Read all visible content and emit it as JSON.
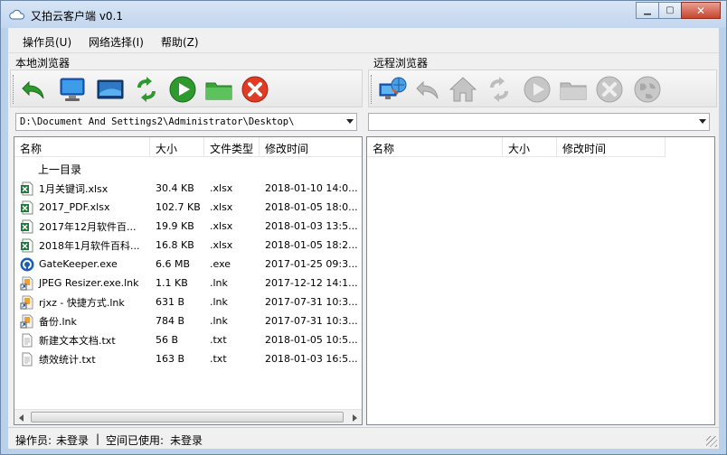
{
  "window": {
    "title": "又拍云客户端 v0.1",
    "controls": [
      "minimize",
      "maximize",
      "close"
    ]
  },
  "menu": {
    "items": [
      "操作员(U)",
      "网络选择(I)",
      "帮助(Z)"
    ]
  },
  "local": {
    "label": "本地浏览器",
    "toolbar": [
      "back-arrow-icon",
      "computer-icon",
      "desktop-icon",
      "refresh-icon",
      "play-icon",
      "folder-icon",
      "delete-icon"
    ],
    "path": "D:\\Document And Settings2\\Administrator\\Desktop\\",
    "columns": [
      "名称",
      "大小",
      "文件类型",
      "修改时间"
    ],
    "parent_dir": "上一目录",
    "files": [
      {
        "name": "1月关键词.xlsx",
        "size": "30.4 KB",
        "type": ".xlsx",
        "modified": "2018-01-10 14:0...",
        "icon": "excel-icon"
      },
      {
        "name": "2017_PDF.xlsx",
        "size": "102.7 KB",
        "type": ".xlsx",
        "modified": "2018-01-05 18:0...",
        "icon": "excel-icon"
      },
      {
        "name": "2017年12月软件百...",
        "size": "19.9 KB",
        "type": ".xlsx",
        "modified": "2018-01-03 13:5...",
        "icon": "excel-icon"
      },
      {
        "name": "2018年1月软件百科...",
        "size": "16.8 KB",
        "type": ".xlsx",
        "modified": "2018-01-05 18:2...",
        "icon": "excel-icon"
      },
      {
        "name": "GateKeeper.exe",
        "size": "6.6 MB",
        "type": ".exe",
        "modified": "2017-01-25 09:3...",
        "icon": "gatekeeper-icon"
      },
      {
        "name": "JPEG Resizer.exe.lnk",
        "size": "1.1 KB",
        "type": ".lnk",
        "modified": "2017-12-12 14:1...",
        "icon": "shortcut-icon"
      },
      {
        "name": "rjxz - 快捷方式.lnk",
        "size": "631 B",
        "type": ".lnk",
        "modified": "2017-07-31 10:3...",
        "icon": "shortcut-icon"
      },
      {
        "name": "备份.lnk",
        "size": "784 B",
        "type": ".lnk",
        "modified": "2017-07-31 10:3...",
        "icon": "shortcut-icon"
      },
      {
        "name": "新建文本文档.txt",
        "size": "56 B",
        "type": ".txt",
        "modified": "2018-01-05 10:5...",
        "icon": "text-file-icon"
      },
      {
        "name": "绩效统计.txt",
        "size": "163 B",
        "type": ".txt",
        "modified": "2018-01-03 16:5...",
        "icon": "text-file-icon"
      }
    ]
  },
  "remote": {
    "label": "远程浏览器",
    "toolbar": [
      "connect-icon",
      "back-arrow-icon",
      "home-icon",
      "refresh-icon",
      "play-icon",
      "folder-icon",
      "delete-icon",
      "globe-icon"
    ],
    "path": "",
    "columns": [
      "名称",
      "大小",
      "修改时间"
    ]
  },
  "status": {
    "operator_label": "操作员:",
    "operator_value": "未登录",
    "separator": "|",
    "space_label": "空间已使用:",
    "space_value": "未登录"
  },
  "colors": {
    "accent_blue": "#1b64c8",
    "title_bg": "#c8daf0",
    "toolbar_green": "#2e9a2e",
    "delete_red": "#e03b24"
  }
}
